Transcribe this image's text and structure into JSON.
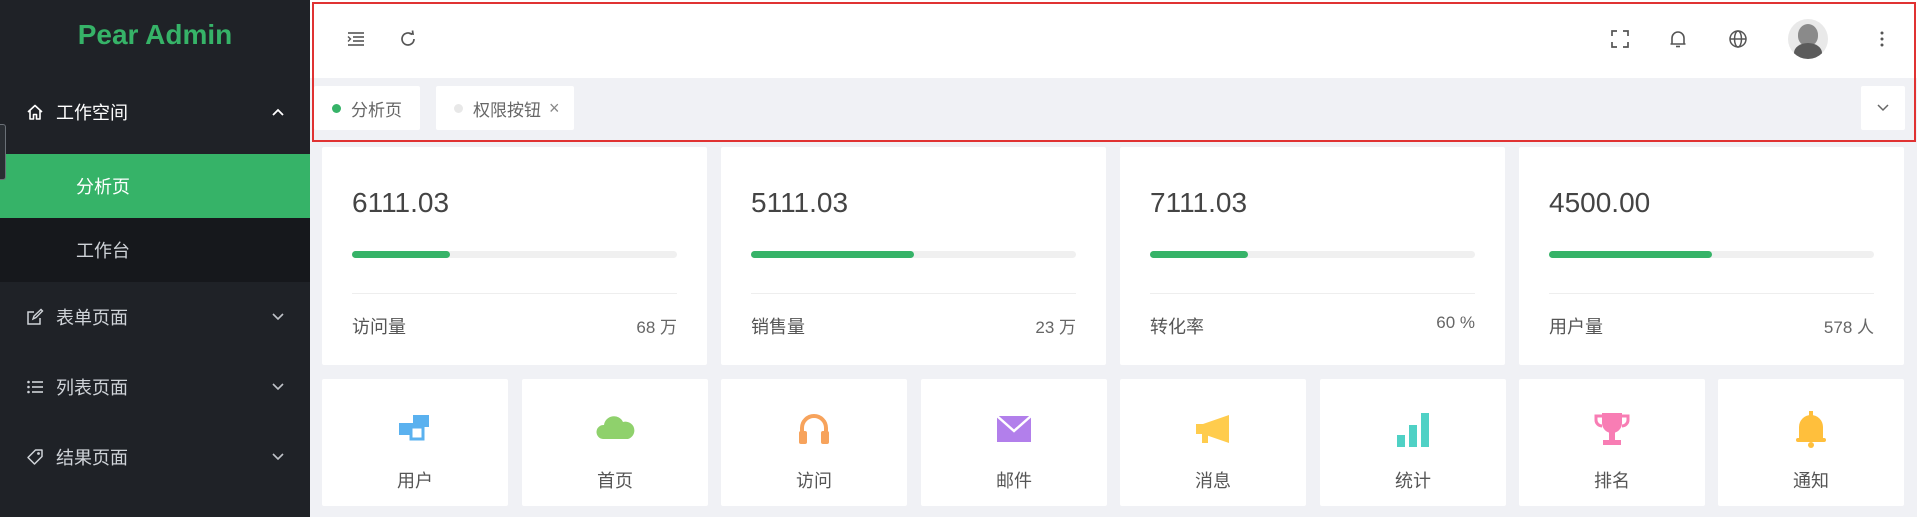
{
  "app": {
    "title": "Pear Admin"
  },
  "sidebar": {
    "groups": [
      {
        "label": "工作空间",
        "icon": "home-icon",
        "expanded": true,
        "items": [
          {
            "label": "分析页",
            "active": true
          },
          {
            "label": "工作台",
            "active": false
          }
        ]
      },
      {
        "label": "表单页面",
        "icon": "edit-icon"
      },
      {
        "label": "列表页面",
        "icon": "list-icon"
      },
      {
        "label": "结果页面",
        "icon": "tag-icon"
      }
    ]
  },
  "header": {
    "left_icons": [
      "menu-fold-icon",
      "refresh-icon"
    ],
    "right_icons": [
      "fullscreen-icon",
      "bell-icon",
      "globe-icon",
      "avatar",
      "more-vertical-icon"
    ]
  },
  "tabs": [
    {
      "label": "分析页",
      "active": true,
      "closable": false
    },
    {
      "label": "权限按钮",
      "active": false,
      "closable": true,
      "close_glyph": "×"
    }
  ],
  "stats": [
    {
      "value": "6111.03",
      "progress": 0.3,
      "label": "访问量",
      "meta": "68 万"
    },
    {
      "value": "5111.03",
      "progress": 0.5,
      "label": "销售量",
      "meta": "23 万"
    },
    {
      "value": "7111.03",
      "progress": 0.3,
      "label": "转化率",
      "meta": "60 %"
    },
    {
      "value": "4500.00",
      "progress": 0.5,
      "label": "用户量",
      "meta": "578 人"
    }
  ],
  "shortcuts": [
    {
      "label": "用户",
      "icon": "users-blocks-icon",
      "color": "#5ab1ef"
    },
    {
      "label": "首页",
      "icon": "cloud-icon",
      "color": "#8fd16c"
    },
    {
      "label": "访问",
      "icon": "headphones-icon",
      "color": "#f7a35c"
    },
    {
      "label": "邮件",
      "icon": "mail-icon",
      "color": "#b27feb"
    },
    {
      "label": "消息",
      "icon": "megaphone-icon",
      "color": "#ffcc4d"
    },
    {
      "label": "统计",
      "icon": "bar-stats-icon",
      "color": "#4fd1c5"
    },
    {
      "label": "排名",
      "icon": "trophy-icon",
      "color": "#f87db4"
    },
    {
      "label": "通知",
      "icon": "bell-fill-icon",
      "color": "#ffbf3c"
    }
  ],
  "colors": {
    "accent": "#36b368",
    "sidebar_bg": "#1f2227",
    "highlight": "#e03232"
  }
}
